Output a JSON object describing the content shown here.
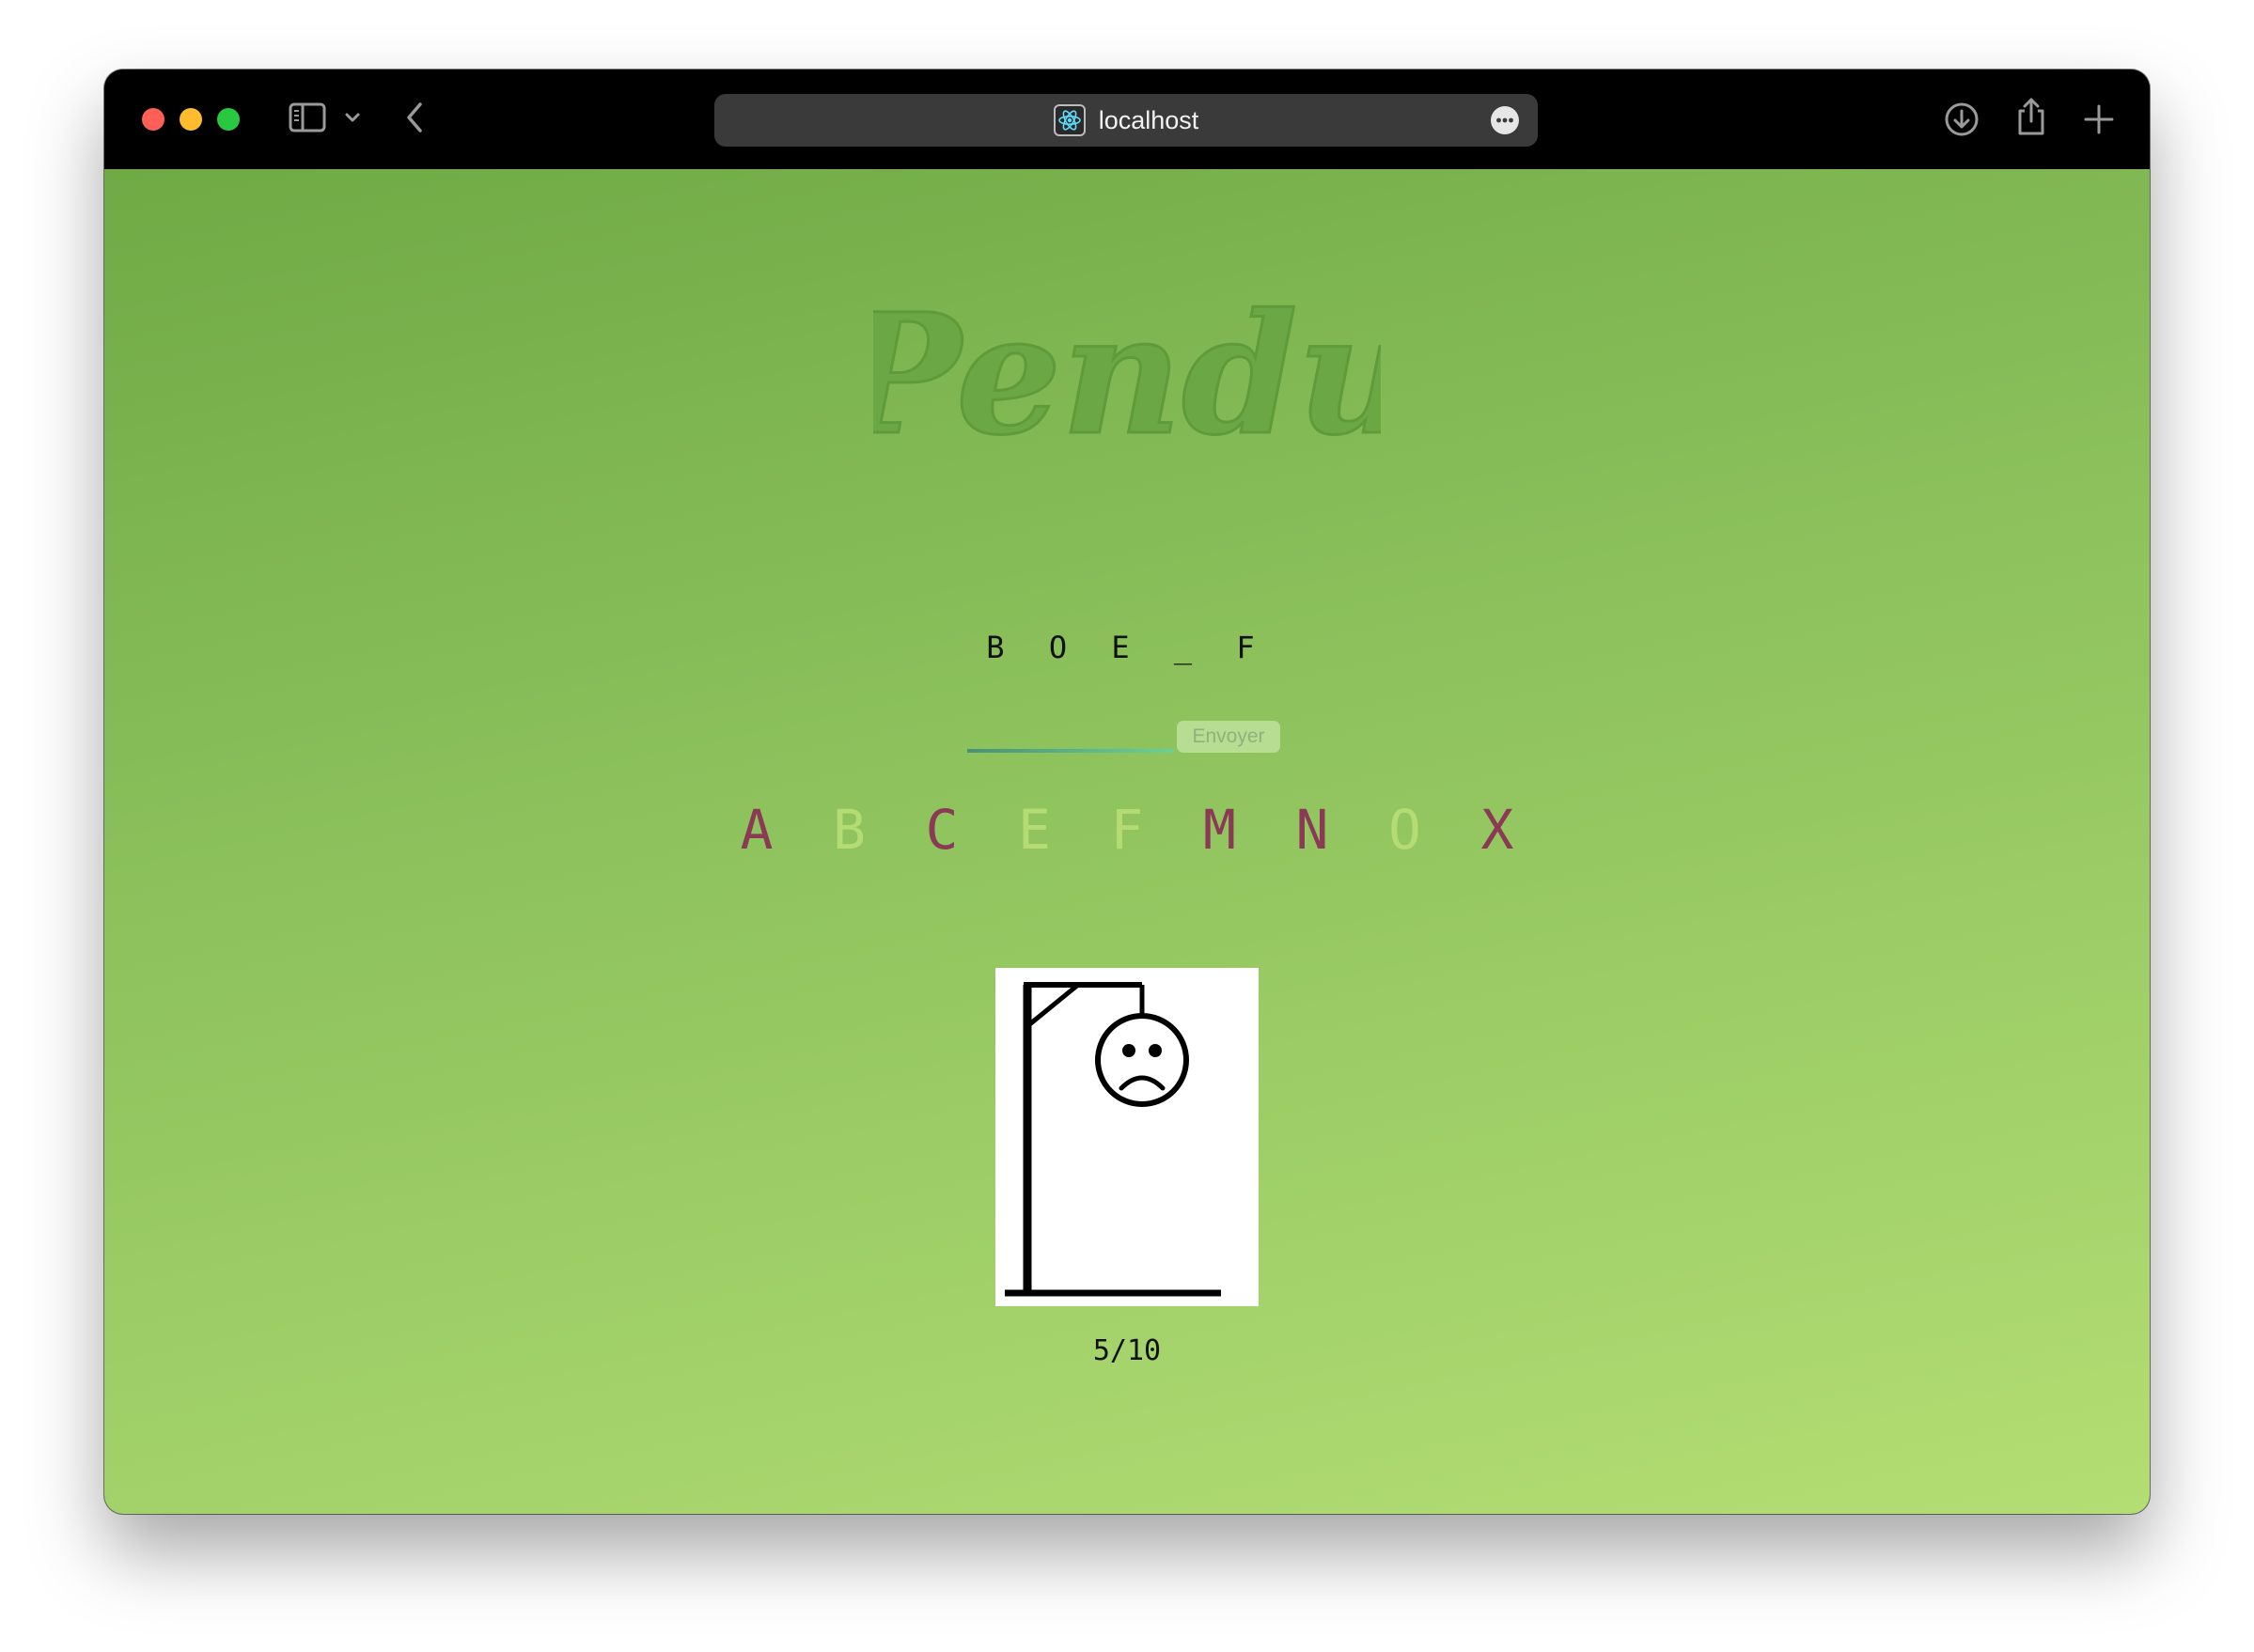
{
  "browser": {
    "url": "localhost",
    "icons": {
      "sidebar": "sidebar-icon",
      "tab_group": "chevron-down-icon",
      "back": "chevron-left-icon",
      "favicon": "react-icon",
      "page_menu": "ellipsis-icon",
      "downloads": "download-icon",
      "share": "share-icon",
      "new_tab": "plus-icon"
    }
  },
  "game": {
    "title": "Pendu",
    "word": "B O E _ F",
    "input_value": "",
    "send_label": "Envoyer",
    "letters": [
      {
        "char": "A",
        "status": "wrong"
      },
      {
        "char": "B",
        "status": "right"
      },
      {
        "char": "C",
        "status": "wrong"
      },
      {
        "char": "E",
        "status": "right"
      },
      {
        "char": "F",
        "status": "right"
      },
      {
        "char": "M",
        "status": "wrong"
      },
      {
        "char": "N",
        "status": "wrong"
      },
      {
        "char": "O",
        "status": "right"
      },
      {
        "char": "X",
        "status": "wrong"
      }
    ],
    "score": "5/10",
    "colors": {
      "wrong": "#8b3a55",
      "right": "#b5dc74",
      "background_start": "#6faa45",
      "background_end": "#b3de73"
    }
  }
}
